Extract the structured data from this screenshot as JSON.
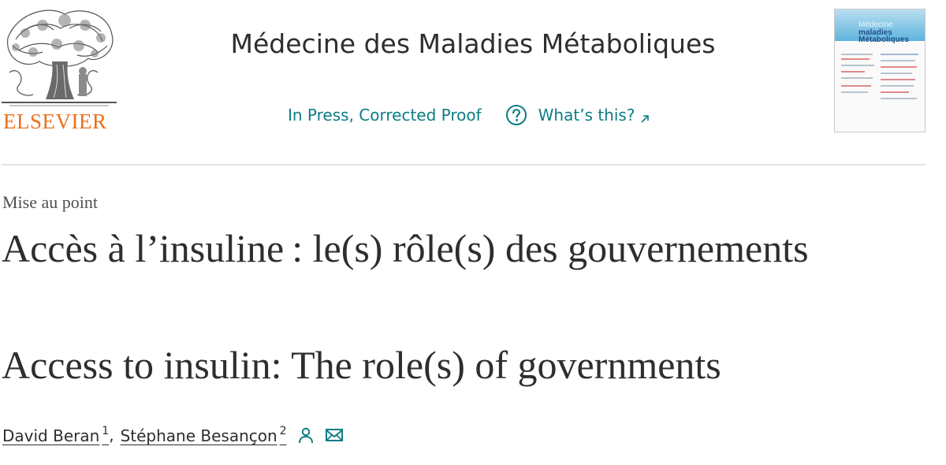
{
  "header": {
    "publisher": "ELSEVIER",
    "journal_title": "Médecine des Maladies Métaboliques",
    "status": "In Press, Corrected Proof",
    "help_link": "What’s this?",
    "cover": {
      "title_line1": "Médecine",
      "title_line2": "maladies",
      "title_line3": "Métaboliques"
    }
  },
  "article": {
    "type": "Mise au point",
    "title_fr": "Accès à l’insuline : le(s) rôle(s) des gouvernements",
    "title_en": "Access to insulin: The role(s) of governments"
  },
  "authors": [
    {
      "name": "David Beran",
      "affiliation": "1"
    },
    {
      "name": "Stéphane Besançon",
      "affiliation": "2"
    }
  ],
  "author_separator": ",",
  "icons": {
    "help": "question-circle-icon",
    "external": "external-link-icon",
    "person": "person-icon",
    "email": "envelope-icon"
  },
  "colors": {
    "publisher_orange": "#e9711c",
    "link_teal": "#0c7d85",
    "text": "#2e2e2e"
  }
}
